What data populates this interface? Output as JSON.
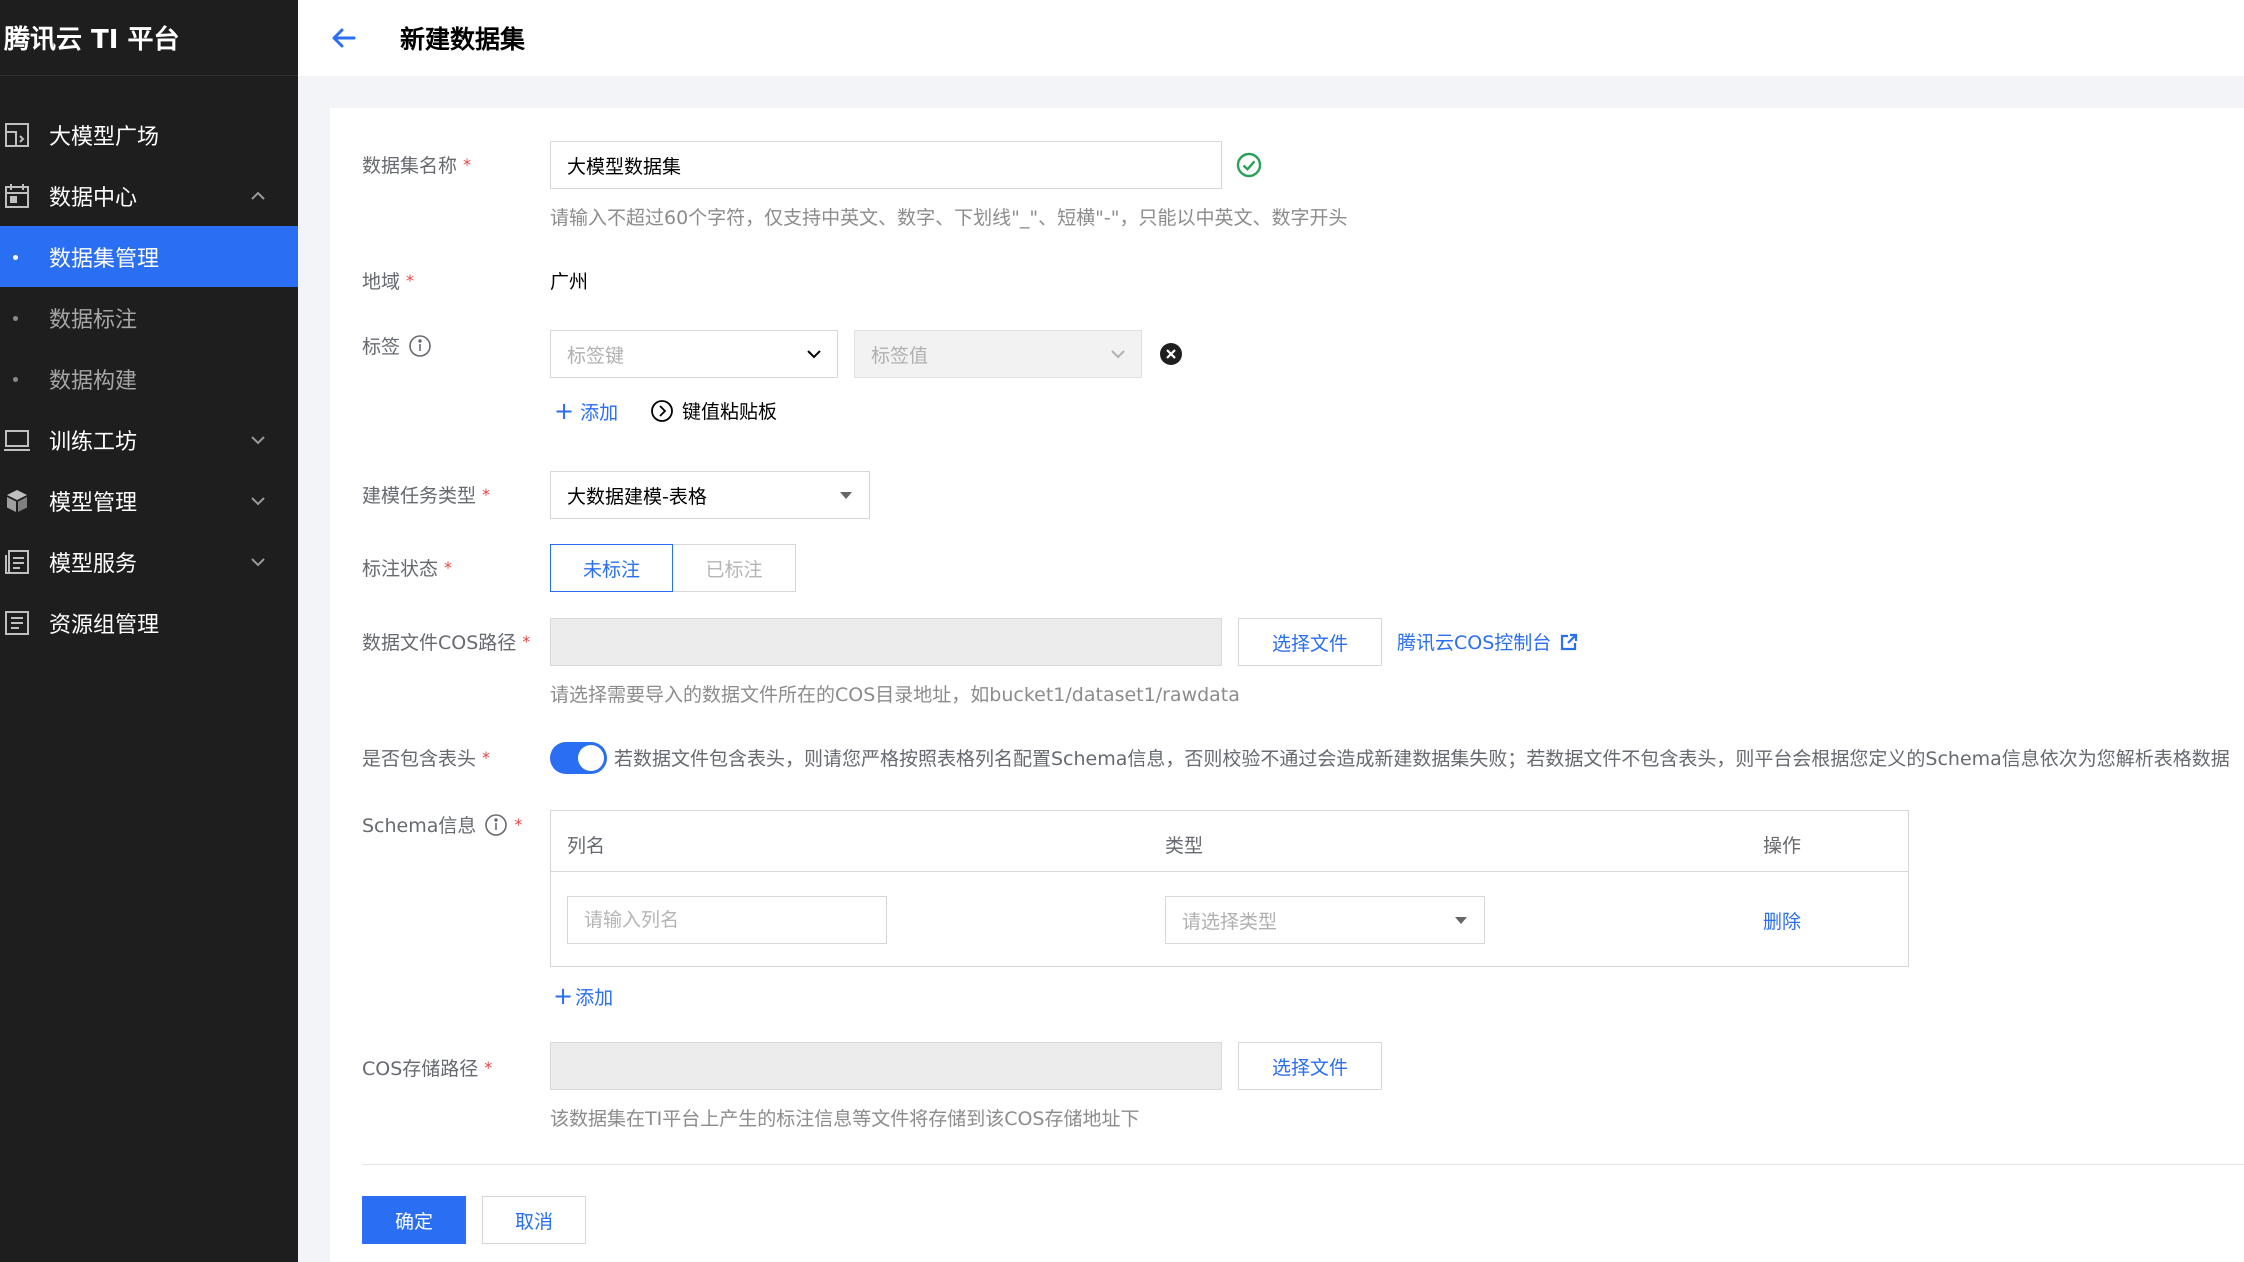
{
  "sidebar": {
    "brand": "腾讯云 TI 平台",
    "items": [
      {
        "label": "大模型广场",
        "icon": "model-square-icon"
      },
      {
        "label": "数据中心",
        "icon": "calendar-icon",
        "expanded": true
      },
      {
        "label": "数据集管理",
        "sub": true,
        "active": true
      },
      {
        "label": "数据标注",
        "sub": true
      },
      {
        "label": "数据构建",
        "sub": true
      },
      {
        "label": "训练工坊",
        "icon": "monitor-icon"
      },
      {
        "label": "模型管理",
        "icon": "cube-icon"
      },
      {
        "label": "模型服务",
        "icon": "service-icon"
      },
      {
        "label": "资源组管理",
        "icon": "list-icon"
      }
    ]
  },
  "header": {
    "title": "新建数据集"
  },
  "form": {
    "name": {
      "label": "数据集名称",
      "value": "大模型数据集",
      "hint": "请输入不超过60个字符，仅支持中英文、数字、下划线\"_\"、短横\"-\"，只能以中英文、数字开头"
    },
    "region": {
      "label": "地域",
      "value": "广州"
    },
    "tags": {
      "label": "标签",
      "key_placeholder": "标签键",
      "value_placeholder": "标签值",
      "add_label": "添加",
      "paste_label": "键值粘贴板"
    },
    "task_type": {
      "label": "建模任务类型",
      "value": "大数据建模-表格"
    },
    "annotation_status": {
      "label": "标注状态",
      "options": [
        "未标注",
        "已标注"
      ],
      "selected": "未标注"
    },
    "cos_path": {
      "label": "数据文件COS路径",
      "value": "",
      "button": "选择文件",
      "console_link": "腾讯云COS控制台",
      "hint": "请选择需要导入的数据文件所在的COS目录地址，如bucket1/dataset1/rawdata"
    },
    "has_header": {
      "label": "是否包含表头",
      "enabled": true,
      "description": "若数据文件包含表头，则请您严格按照表格列名配置Schema信息，否则校验不通过会造成新建数据集失败；若数据文件不包含表头，则平台会根据您定义的Schema信息依次为您解析表格数据"
    },
    "schema": {
      "label": "Schema信息",
      "columns": [
        "列名",
        "类型",
        "操作"
      ],
      "rows": [
        {
          "name_placeholder": "请输入列名",
          "type_placeholder": "请选择类型",
          "action": "删除"
        }
      ],
      "add_label": "添加"
    },
    "storage_path": {
      "label": "COS存储路径",
      "value": "",
      "button": "选择文件",
      "hint": "该数据集在TI平台上产生的标注信息等文件将存储到该COS存储地址下"
    },
    "actions": {
      "confirm": "确定",
      "cancel": "取消"
    }
  },
  "colors": {
    "accent": "#2a6ef3",
    "sidebar_bg": "#1e1e1e",
    "required": "#e54545",
    "success": "#2aa15a"
  }
}
